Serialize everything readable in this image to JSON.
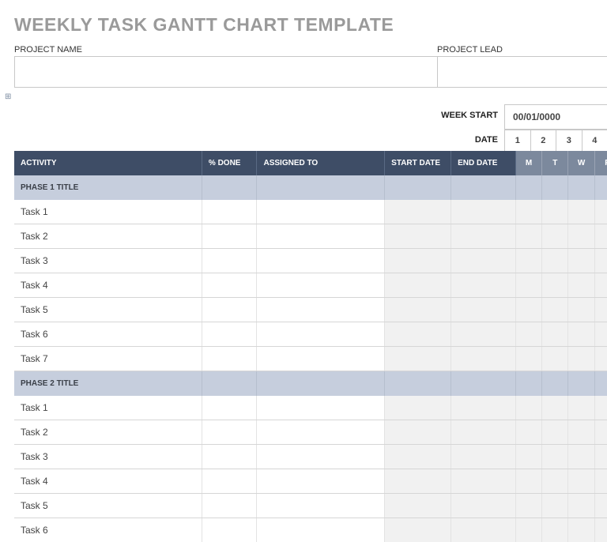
{
  "title": "WEEKLY TASK GANTT CHART TEMPLATE",
  "meta": {
    "project_name_label": "PROJECT NAME",
    "project_lead_label": "PROJECT LEAD"
  },
  "week_start_label": "WEEK START",
  "week_start_value": "00/01/0000",
  "date_label": "DATE",
  "date_numbers": [
    "1",
    "2",
    "3",
    "4"
  ],
  "columns": {
    "activity": "ACTIVITY",
    "pct_done": "% DONE",
    "assigned_to": "ASSIGNED TO",
    "start_date": "START DATE",
    "end_date": "END DATE"
  },
  "day_headers": [
    "M",
    "T",
    "W",
    "R"
  ],
  "phases": [
    {
      "title": "PHASE 1 TITLE",
      "tasks": [
        "Task 1",
        "Task 2",
        "Task 3",
        "Task 4",
        "Task 5",
        "Task 6",
        "Task 7"
      ]
    },
    {
      "title": "PHASE 2 TITLE",
      "tasks": [
        "Task 1",
        "Task 2",
        "Task 3",
        "Task 4",
        "Task 5",
        "Task 6"
      ]
    }
  ],
  "expand_glyph": "⊞"
}
